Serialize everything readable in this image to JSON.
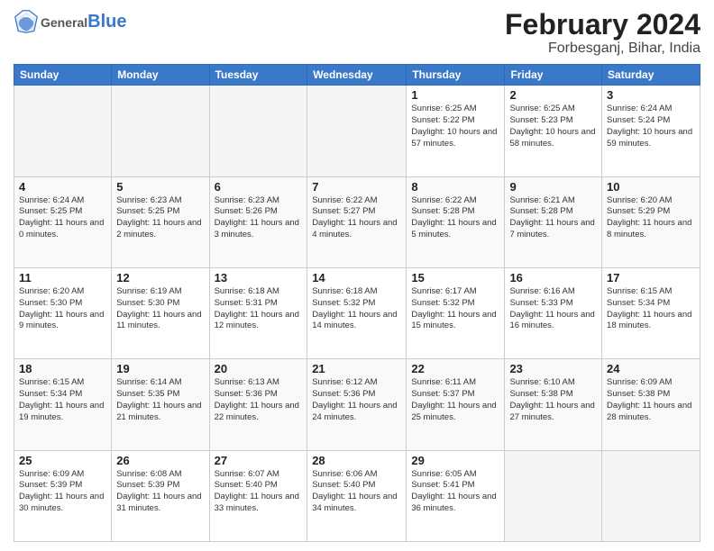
{
  "header": {
    "logo_general": "General",
    "logo_blue": "Blue",
    "month": "February 2024",
    "location": "Forbesganj, Bihar, India"
  },
  "weekdays": [
    "Sunday",
    "Monday",
    "Tuesday",
    "Wednesday",
    "Thursday",
    "Friday",
    "Saturday"
  ],
  "weeks": [
    [
      {
        "day": "",
        "empty": true
      },
      {
        "day": "",
        "empty": true
      },
      {
        "day": "",
        "empty": true
      },
      {
        "day": "",
        "empty": true
      },
      {
        "day": "1",
        "sunrise": "6:25 AM",
        "sunset": "5:22 PM",
        "daylight": "10 hours and 57 minutes."
      },
      {
        "day": "2",
        "sunrise": "6:25 AM",
        "sunset": "5:23 PM",
        "daylight": "10 hours and 58 minutes."
      },
      {
        "day": "3",
        "sunrise": "6:24 AM",
        "sunset": "5:24 PM",
        "daylight": "10 hours and 59 minutes."
      }
    ],
    [
      {
        "day": "4",
        "sunrise": "6:24 AM",
        "sunset": "5:25 PM",
        "daylight": "11 hours and 0 minutes."
      },
      {
        "day": "5",
        "sunrise": "6:23 AM",
        "sunset": "5:25 PM",
        "daylight": "11 hours and 2 minutes."
      },
      {
        "day": "6",
        "sunrise": "6:23 AM",
        "sunset": "5:26 PM",
        "daylight": "11 hours and 3 minutes."
      },
      {
        "day": "7",
        "sunrise": "6:22 AM",
        "sunset": "5:27 PM",
        "daylight": "11 hours and 4 minutes."
      },
      {
        "day": "8",
        "sunrise": "6:22 AM",
        "sunset": "5:28 PM",
        "daylight": "11 hours and 5 minutes."
      },
      {
        "day": "9",
        "sunrise": "6:21 AM",
        "sunset": "5:28 PM",
        "daylight": "11 hours and 7 minutes."
      },
      {
        "day": "10",
        "sunrise": "6:20 AM",
        "sunset": "5:29 PM",
        "daylight": "11 hours and 8 minutes."
      }
    ],
    [
      {
        "day": "11",
        "sunrise": "6:20 AM",
        "sunset": "5:30 PM",
        "daylight": "11 hours and 9 minutes."
      },
      {
        "day": "12",
        "sunrise": "6:19 AM",
        "sunset": "5:30 PM",
        "daylight": "11 hours and 11 minutes."
      },
      {
        "day": "13",
        "sunrise": "6:18 AM",
        "sunset": "5:31 PM",
        "daylight": "11 hours and 12 minutes."
      },
      {
        "day": "14",
        "sunrise": "6:18 AM",
        "sunset": "5:32 PM",
        "daylight": "11 hours and 14 minutes."
      },
      {
        "day": "15",
        "sunrise": "6:17 AM",
        "sunset": "5:32 PM",
        "daylight": "11 hours and 15 minutes."
      },
      {
        "day": "16",
        "sunrise": "6:16 AM",
        "sunset": "5:33 PM",
        "daylight": "11 hours and 16 minutes."
      },
      {
        "day": "17",
        "sunrise": "6:15 AM",
        "sunset": "5:34 PM",
        "daylight": "11 hours and 18 minutes."
      }
    ],
    [
      {
        "day": "18",
        "sunrise": "6:15 AM",
        "sunset": "5:34 PM",
        "daylight": "11 hours and 19 minutes."
      },
      {
        "day": "19",
        "sunrise": "6:14 AM",
        "sunset": "5:35 PM",
        "daylight": "11 hours and 21 minutes."
      },
      {
        "day": "20",
        "sunrise": "6:13 AM",
        "sunset": "5:36 PM",
        "daylight": "11 hours and 22 minutes."
      },
      {
        "day": "21",
        "sunrise": "6:12 AM",
        "sunset": "5:36 PM",
        "daylight": "11 hours and 24 minutes."
      },
      {
        "day": "22",
        "sunrise": "6:11 AM",
        "sunset": "5:37 PM",
        "daylight": "11 hours and 25 minutes."
      },
      {
        "day": "23",
        "sunrise": "6:10 AM",
        "sunset": "5:38 PM",
        "daylight": "11 hours and 27 minutes."
      },
      {
        "day": "24",
        "sunrise": "6:09 AM",
        "sunset": "5:38 PM",
        "daylight": "11 hours and 28 minutes."
      }
    ],
    [
      {
        "day": "25",
        "sunrise": "6:09 AM",
        "sunset": "5:39 PM",
        "daylight": "11 hours and 30 minutes."
      },
      {
        "day": "26",
        "sunrise": "6:08 AM",
        "sunset": "5:39 PM",
        "daylight": "11 hours and 31 minutes."
      },
      {
        "day": "27",
        "sunrise": "6:07 AM",
        "sunset": "5:40 PM",
        "daylight": "11 hours and 33 minutes."
      },
      {
        "day": "28",
        "sunrise": "6:06 AM",
        "sunset": "5:40 PM",
        "daylight": "11 hours and 34 minutes."
      },
      {
        "day": "29",
        "sunrise": "6:05 AM",
        "sunset": "5:41 PM",
        "daylight": "11 hours and 36 minutes."
      },
      {
        "day": "",
        "empty": true
      },
      {
        "day": "",
        "empty": true
      }
    ]
  ]
}
